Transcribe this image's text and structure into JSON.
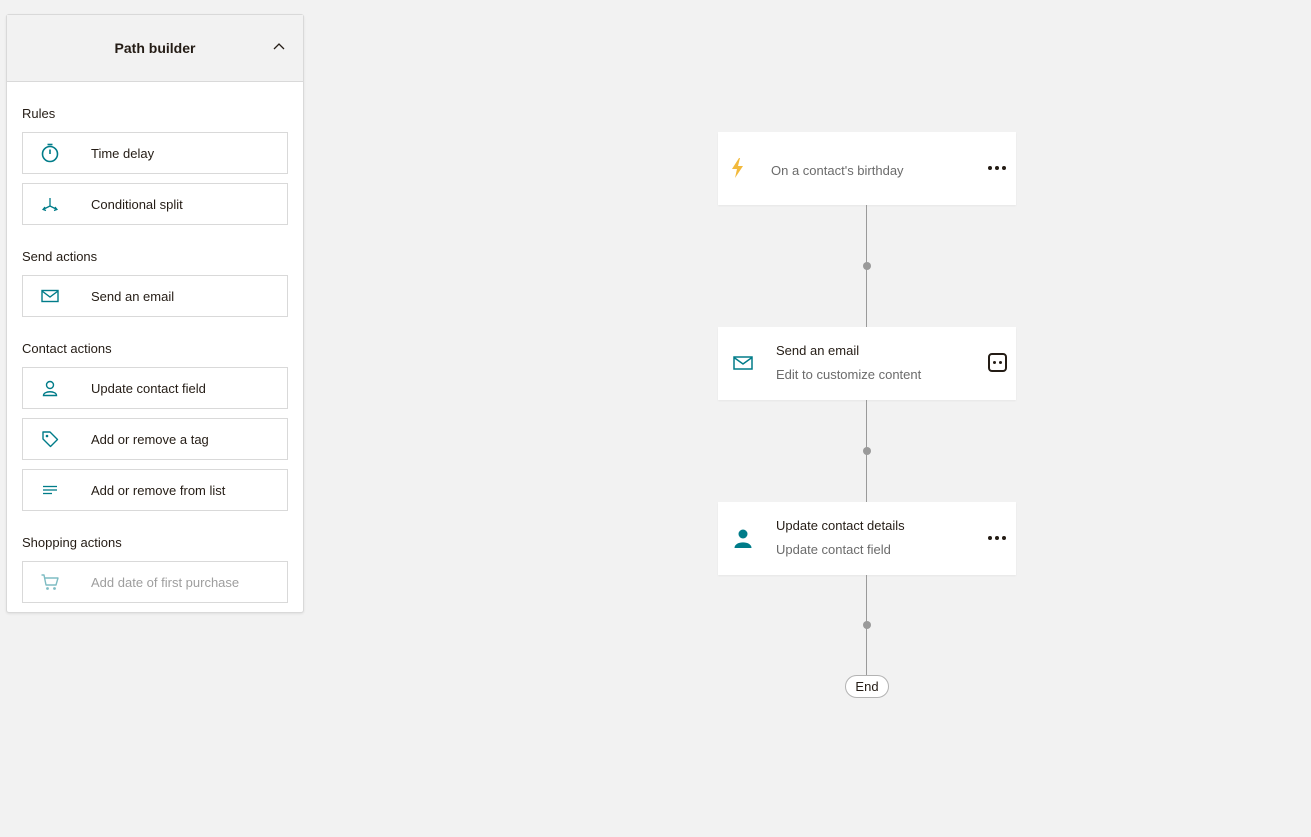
{
  "panel": {
    "title": "Path builder",
    "sections": {
      "rules": {
        "title": "Rules",
        "items": [
          "Time delay",
          "Conditional split"
        ]
      },
      "send": {
        "title": "Send actions",
        "items": [
          "Send an email"
        ]
      },
      "contact": {
        "title": "Contact actions",
        "items": [
          "Update contact field",
          "Add or remove a tag",
          "Add or remove from list"
        ]
      },
      "shopping": {
        "title": "Shopping actions",
        "items": [
          "Add date of first purchase"
        ]
      }
    }
  },
  "flow": {
    "trigger": {
      "label": "On a contact's birthday",
      "icon": "lightning-icon"
    },
    "email": {
      "title": "Send an email",
      "subtitle": "Edit to customize content",
      "icon": "envelope-icon"
    },
    "contact": {
      "title": "Update contact details",
      "subtitle": "Update contact field",
      "icon": "person-icon"
    },
    "end_label": "End"
  },
  "colors": {
    "accent_teal": "#007c89",
    "trigger_yellow": "#f2b93b",
    "connector_gray": "#9a9a9a",
    "canvas_bg": "#f2f2f2"
  }
}
